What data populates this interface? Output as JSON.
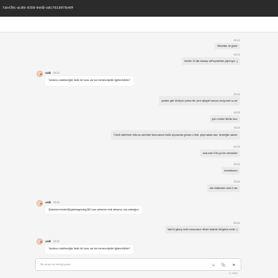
{
  "browser": {
    "url": "7ae4f9c-ac85-4006-9e8b-a6c7615976e8#"
  },
  "composer": {
    "placeholder": "Bu aracı'na mesaj yazın",
    "counter": "0 / 3000",
    "icons": [
      "emoji-icon",
      "attach-icon",
      "send-icon"
    ]
  },
  "messages": [
    {
      "side": "out",
      "time": "09:24",
      "text": "Selamlar ne güzel"
    },
    {
      "side": "out",
      "time": "09:24",
      "text": "fonelle 10 fab kasasy vaPaymetinfo yapmıyor :("
    },
    {
      "side": "in",
      "name": "ukiB",
      "time": "09:24",
      "text": "Yardımcı olabileceğim farklı bir konu var ise memnuniyetle ilgilenebilirim?"
    },
    {
      "side": "out",
      "time": "09:25",
      "text": "yardım geri dönüyor yoksa her yere şikayet konusu ancyorum su an"
    },
    {
      "side": "out",
      "time": "09:25",
      "text": "yok o bekle feklük kırcı"
    },
    {
      "side": "out",
      "time": "09:25",
      "text": "Farklı sitelereen folla su semimle foturculanın farklı siyonunlar görses o bilsi, peşe aalan size, ürneeğim sarare"
    },
    {
      "side": "out",
      "time": "09:25",
      "text": "ama size fi 5k ya her zermekim"
    },
    {
      "side": "out",
      "time": "09:26",
      "text": "kemettonno"
    },
    {
      "side": "out",
      "time": "09:26",
      "text": "dün fabaklıarn sizin ir ise"
    },
    {
      "side": "in",
      "name": "ukiB",
      "time": "09:26",
      "text": "Şüleerben tezkell@patheageering360.com adresine mail atmanızı rica ederağım"
    },
    {
      "side": "out",
      "time": "09:26",
      "text": "fakit hi gitsey nebe konusunun hilmni fadimin ilekğeiris meke :)"
    },
    {
      "side": "in",
      "name": "ukiB",
      "time": "09:26",
      "text": "Yardımcı olabileceğim farklı bir konu var ise memnuniyetle ilgilenebilirim?"
    }
  ]
}
